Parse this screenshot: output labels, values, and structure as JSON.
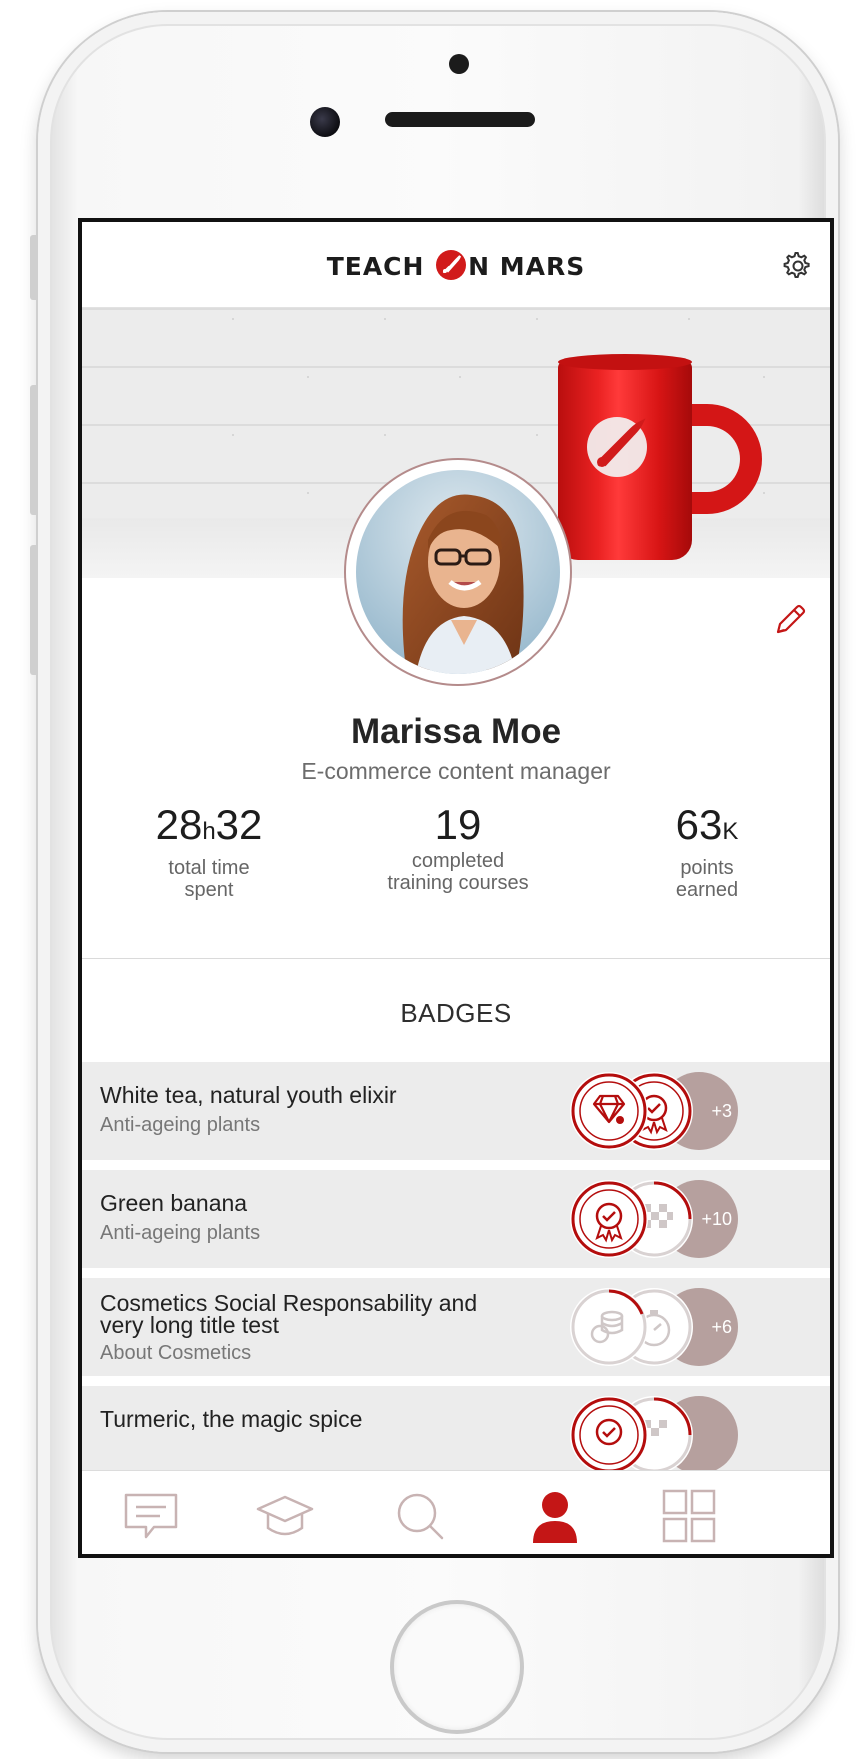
{
  "app": {
    "brand_left": "TEACH",
    "brand_right": "N MARS"
  },
  "colors": {
    "accent": "#d11b1b",
    "badge_more": "#b6a09e",
    "row_bg": "#ececec"
  },
  "profile": {
    "name": "Marissa Moe",
    "role": "E-commerce content manager"
  },
  "stats": [
    {
      "value_a": "28",
      "unit_a": "h",
      "value_b": "32",
      "label_1": "total time",
      "label_2": "spent"
    },
    {
      "value_a": "19",
      "unit_a": "",
      "value_b": "",
      "label_1": "completed",
      "label_2": "training courses"
    },
    {
      "value_a": "63",
      "unit_a": "K",
      "value_b": "",
      "label_1": "points",
      "label_2": "earned"
    }
  ],
  "badges_section": {
    "title": "BADGES"
  },
  "badges": [
    {
      "title": "White tea, natural youth elixir",
      "subtitle": "Anti-ageing plants",
      "more": "+3",
      "icons": [
        "diamond-badge",
        "award-badge"
      ]
    },
    {
      "title": "Green banana",
      "subtitle": "Anti-ageing plants",
      "more": "+10",
      "icons": [
        "award-badge",
        "checkered-flag-badge"
      ]
    },
    {
      "title": "Cosmetics Social Responsability and very long title test",
      "subtitle": "About Cosmetics",
      "more": "+6",
      "icons": [
        "coins-badge",
        "stopwatch-badge"
      ]
    },
    {
      "title": "Turmeric, the magic spice",
      "subtitle": "",
      "more": "",
      "icons": [
        "award-badge",
        "checkered-flag-badge"
      ]
    }
  ],
  "tabbar": [
    {
      "name": "messages",
      "icon": "chat-icon",
      "active": false
    },
    {
      "name": "training",
      "icon": "graduation-cap-icon",
      "active": false
    },
    {
      "name": "search",
      "icon": "search-icon",
      "active": false
    },
    {
      "name": "profile",
      "icon": "user-icon",
      "active": true
    },
    {
      "name": "catalog",
      "icon": "grid-icon",
      "active": false
    }
  ]
}
